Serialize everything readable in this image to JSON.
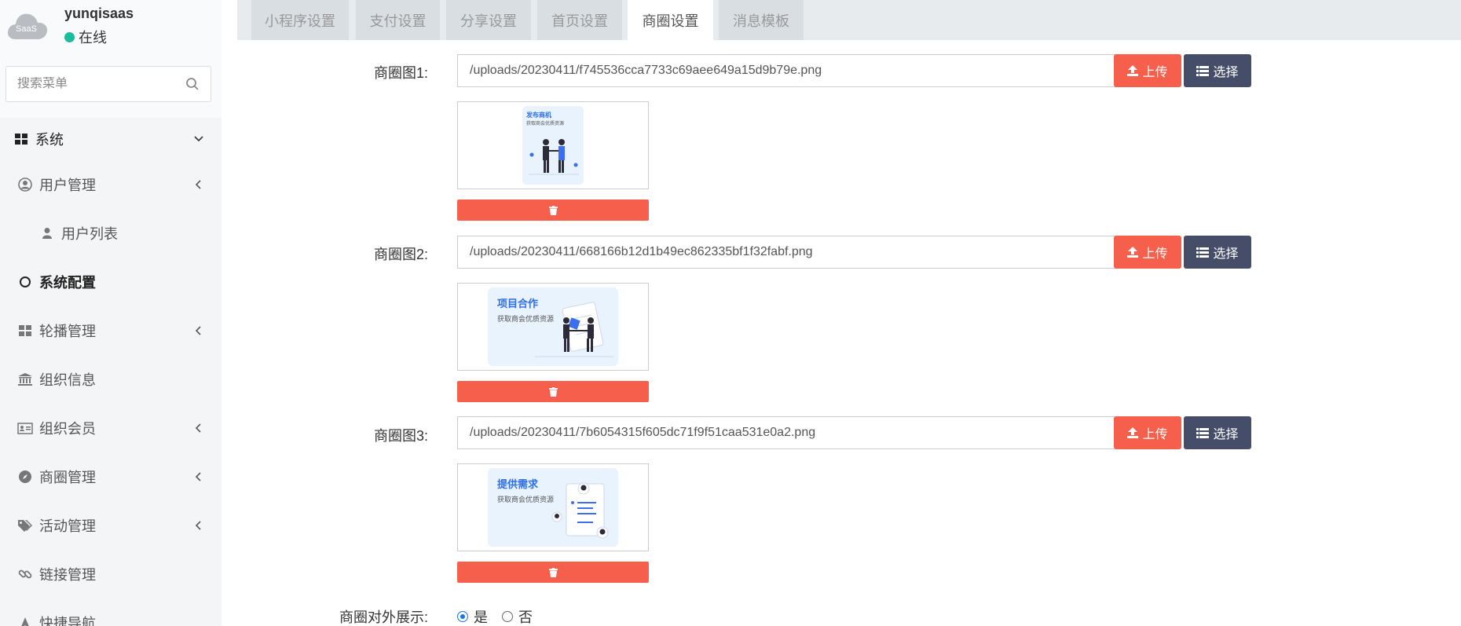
{
  "user": {
    "name": "yunqisaas",
    "status": "在线",
    "avatar_text": "SaaS"
  },
  "search": {
    "placeholder": "搜索菜单"
  },
  "menu": {
    "system": "系统",
    "user_mgmt": "用户管理",
    "user_list": "用户列表",
    "sys_config": "系统配置",
    "carousel": "轮播管理",
    "org_info": "组织信息",
    "org_member": "组织会员",
    "circle_mgmt": "商圈管理",
    "activity": "活动管理",
    "links": "链接管理",
    "quick_nav": "快捷导航"
  },
  "tabs": [
    "小程序设置",
    "支付设置",
    "分享设置",
    "首页设置",
    "商圈设置",
    "消息模板"
  ],
  "active_tab": "商圈设置",
  "images": [
    {
      "label": "商圈图1:",
      "path": "/uploads/20230411/f745536cca7733c69aee649a15d9b79e.png",
      "thumb_title": "发布商机",
      "thumb_sub": "获取商会优质资源"
    },
    {
      "label": "商圈图2:",
      "path": "/uploads/20230411/668166b12d1b49ec862335bf1f32fabf.png",
      "thumb_title": "项目合作",
      "thumb_sub": "获取商会优质资源"
    },
    {
      "label": "商圈图3:",
      "path": "/uploads/20230411/7b6054315f605dc71f9f51caa531e0a2.png",
      "thumb_title": "提供需求",
      "thumb_sub": "获取商会优质资源"
    }
  ],
  "buttons": {
    "upload": "上传",
    "select": "选择"
  },
  "public_display": {
    "label": "商圈对外展示:",
    "yes": "是",
    "no": "否",
    "selected": "是"
  },
  "colors": {
    "danger": "#f55f4c",
    "dark": "#454d68",
    "online": "#1bbc9b",
    "radio": "#1a73e8"
  }
}
